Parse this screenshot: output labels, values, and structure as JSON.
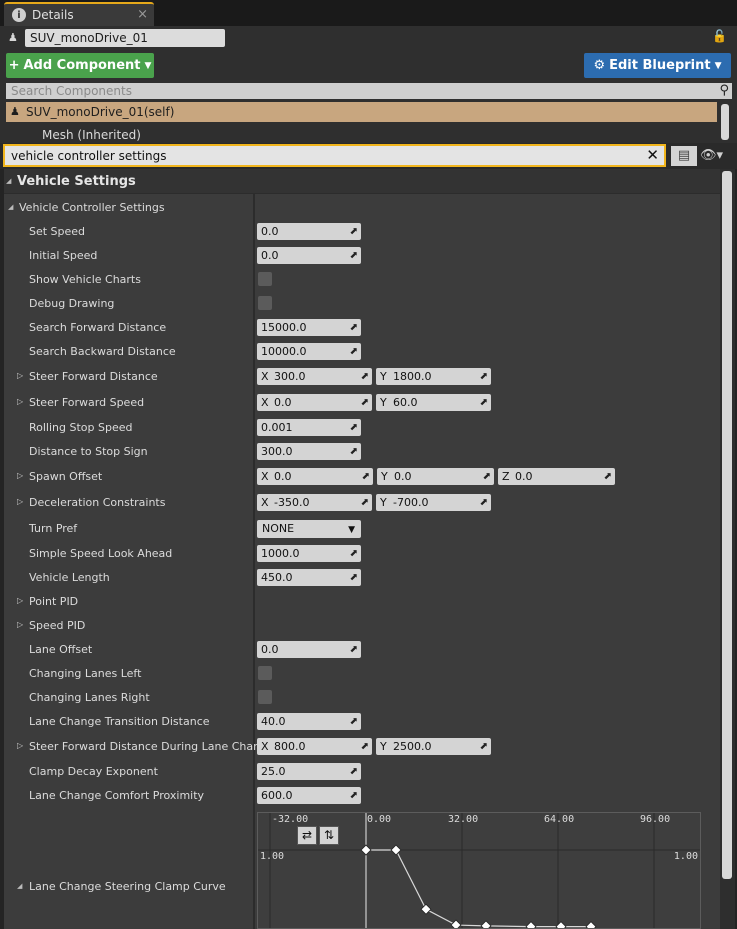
{
  "tab": {
    "icon": "info-icon",
    "label": "Details",
    "close": "×"
  },
  "actor": {
    "name": "SUV_monoDrive_01",
    "lock": "lock-icon"
  },
  "toolbar": {
    "add_component": "Add Component",
    "edit_blueprint": "Edit Blueprint"
  },
  "search_components": {
    "placeholder": "Search Components"
  },
  "components": {
    "self": "SUV_monoDrive_01(self)",
    "mesh": "Mesh (Inherited)"
  },
  "filter": {
    "value": "vehicle controller settings"
  },
  "category": "Vehicle Settings",
  "group": "Vehicle Controller Settings",
  "properties": [
    {
      "label": "Set Speed",
      "type": "num",
      "v": [
        "0.0"
      ]
    },
    {
      "label": "Initial Speed",
      "type": "num",
      "v": [
        "0.0"
      ]
    },
    {
      "label": "Show Vehicle Charts",
      "type": "check",
      "checked": false
    },
    {
      "label": "Debug Drawing",
      "type": "check",
      "checked": false
    },
    {
      "label": "Search Forward Distance",
      "type": "num",
      "v": [
        "15000.0"
      ]
    },
    {
      "label": "Search Backward Distance",
      "type": "num",
      "v": [
        "10000.0"
      ]
    },
    {
      "label": "Steer Forward Distance",
      "type": "vec",
      "expand": true,
      "v": [
        "300.0",
        "1800.0"
      ]
    },
    {
      "label": "Steer Forward Speed",
      "type": "vec",
      "expand": true,
      "v": [
        "0.0",
        "60.0"
      ]
    },
    {
      "label": "Rolling Stop Speed",
      "type": "num",
      "v": [
        "0.001"
      ]
    },
    {
      "label": "Distance to Stop Sign",
      "type": "num",
      "v": [
        "300.0"
      ]
    },
    {
      "label": "Spawn Offset",
      "type": "vec3",
      "expand": true,
      "v": [
        "0.0",
        "0.0",
        "0.0"
      ]
    },
    {
      "label": "Deceleration Constraints",
      "type": "vec",
      "expand": true,
      "v": [
        "-350.0",
        "-700.0"
      ]
    },
    {
      "label": "Turn Pref",
      "type": "select",
      "v": [
        "NONE"
      ]
    },
    {
      "label": "Simple Speed Look Ahead",
      "type": "num",
      "v": [
        "1000.0"
      ]
    },
    {
      "label": "Vehicle Length",
      "type": "num",
      "v": [
        "450.0"
      ]
    },
    {
      "label": "Point PID",
      "type": "none",
      "expand": true
    },
    {
      "label": "Speed PID",
      "type": "none",
      "expand": true
    },
    {
      "label": "Lane Offset",
      "type": "num",
      "v": [
        "0.0"
      ]
    },
    {
      "label": "Changing Lanes Left",
      "type": "check",
      "checked": false
    },
    {
      "label": "Changing Lanes Right",
      "type": "check",
      "checked": false
    },
    {
      "label": "Lane Change Transition Distance",
      "type": "num",
      "v": [
        "40.0"
      ]
    },
    {
      "label": "Steer Forward Distance During Lane Change",
      "type": "vec",
      "expand": true,
      "v": [
        "800.0",
        "2500.0"
      ]
    },
    {
      "label": "Clamp Decay Exponent",
      "type": "num",
      "v": [
        "25.0"
      ]
    },
    {
      "label": "Lane Change Comfort Proximity",
      "type": "num",
      "v": [
        "600.0"
      ]
    }
  ],
  "curve": {
    "label": "Lane Change Steering Clamp Curve",
    "x_ticks": [
      "-32.00",
      "0.00",
      "32.00",
      "64.00",
      "96.00"
    ],
    "y_left": "1.00",
    "y_right": "1.00",
    "keys": [
      {
        "x": 0,
        "y": 1.0
      },
      {
        "x": 10,
        "y": 1.0
      },
      {
        "x": 20,
        "y": 0.25
      },
      {
        "x": 30,
        "y": 0.05
      },
      {
        "x": 40,
        "y": 0.04
      },
      {
        "x": 55,
        "y": 0.03
      },
      {
        "x": 65,
        "y": 0.03
      },
      {
        "x": 75,
        "y": 0.03
      }
    ]
  }
}
